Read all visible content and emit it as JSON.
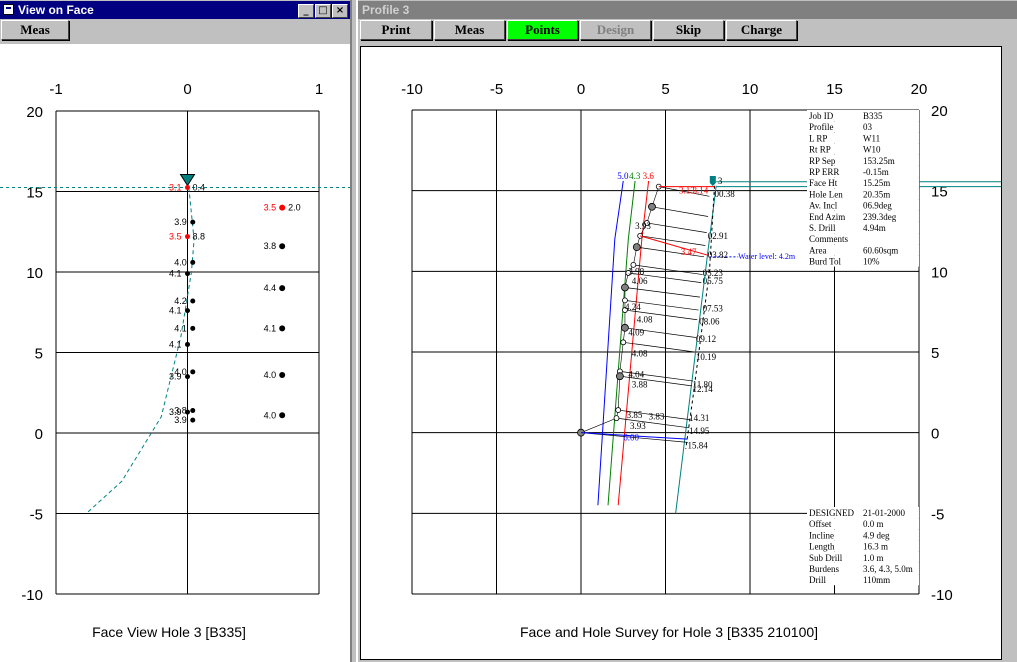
{
  "left_window": {
    "title": "View on Face",
    "buttons": {
      "minimize": "_",
      "maximize": "□",
      "close": "×"
    },
    "toolbar": {
      "meas": "Meas"
    },
    "caption": "Face View Hole 3 [B335]"
  },
  "right_window": {
    "title": "Profile 3",
    "toolbar": {
      "print": "Print",
      "meas": "Meas",
      "points": "Points",
      "design": "Design",
      "skip": "Skip",
      "charge": "Charge"
    },
    "caption": "Face and Hole Survey for Hole  3 [B335 210100]",
    "info_top": [
      [
        "Job ID",
        "B335"
      ],
      [
        "Profile",
        "03"
      ],
      [
        "L RP",
        "W11"
      ],
      [
        "Rt RP",
        "W10"
      ],
      [
        "RP Sep",
        "153.25m"
      ],
      [
        "RP ERR",
        "-0.15m"
      ],
      [
        "Face Ht",
        "15.25m"
      ],
      [
        "Hole Len",
        "20.35m"
      ],
      [
        "Av. Incl",
        "06.9deg"
      ],
      [
        "End Azim",
        "239.3deg"
      ],
      [
        "S. Drill",
        "4.94m"
      ],
      [
        "Comments",
        ""
      ],
      [
        "Area",
        "60.60sqm"
      ],
      [
        "Burd Tol",
        "10%"
      ]
    ],
    "info_bottom": [
      [
        "DESIGNED",
        "21-01-2000"
      ],
      [
        "Offset",
        "0.0 m"
      ],
      [
        "Incline",
        "4.9 deg"
      ],
      [
        "Length",
        "16.3 m"
      ],
      [
        "Sub Drill",
        "1.0 m"
      ],
      [
        "Burdens",
        "3.6, 4.3, 5.0m"
      ],
      [
        "Drill",
        "110mm"
      ]
    ],
    "water_level": "Water level: 4.2m"
  },
  "colors": {
    "accent_active": "#00ff00",
    "title_active": "#000080",
    "red": "#ff0000",
    "teal": "#008080",
    "blue": "#0000ff",
    "green": "#008000"
  },
  "chart_data": [
    {
      "type": "scatter",
      "xlim": [
        -1,
        1
      ],
      "ylim": [
        -10,
        20
      ],
      "x_ticks": [
        "-1",
        "0",
        "1"
      ],
      "y_ticks": [
        "20",
        "15",
        "10",
        "5",
        "0",
        "-5",
        "-10"
      ],
      "face_line_y": 15.25,
      "hole_points": [
        {
          "y": 15.25,
          "lbl_l": "3.1",
          "lbl_r": "0.4",
          "red": true
        },
        {
          "y": 13.1,
          "lbl_l": "3.9",
          "red": false
        },
        {
          "y": 12.2,
          "lbl_l": "3.5",
          "lbl_r": "8.8",
          "red": true
        },
        {
          "y": 10.6,
          "lbl_l": "4.0",
          "red": false
        },
        {
          "y": 9.9,
          "lbl_l": "4.1",
          "red": false
        },
        {
          "y": 8.2,
          "lbl_l": "4.2",
          "red": false
        },
        {
          "y": 7.6,
          "lbl_l": "4.1",
          "red": false
        },
        {
          "y": 6.5,
          "lbl_l": "4.1",
          "red": false
        },
        {
          "y": 5.5,
          "lbl_l": "4.1",
          "red": false
        },
        {
          "y": 3.8,
          "lbl_l": "4.0",
          "red": false
        },
        {
          "y": 3.5,
          "lbl_l": "3.9",
          "red": false
        },
        {
          "y": 1.4,
          "lbl_l": "3.8",
          "red": false
        },
        {
          "y": 1.3,
          "lbl_l": "3.9",
          "red": false
        },
        {
          "y": 0.8,
          "lbl_l": "3.9",
          "red": false
        }
      ],
      "burden_points": [
        {
          "y": 14.0,
          "label": "3.5",
          "val": "2.0",
          "red": true
        },
        {
          "y": 11.6,
          "label": "3.8",
          "red": false
        },
        {
          "y": 9.0,
          "label": "4.4",
          "red": false
        },
        {
          "y": 6.5,
          "label": "4.1",
          "red": false
        },
        {
          "y": 3.6,
          "label": "4.0",
          "red": false
        },
        {
          "y": 1.1,
          "label": "4.0",
          "red": false
        }
      ]
    },
    {
      "type": "line",
      "xlim": [
        -10,
        20
      ],
      "ylim": [
        -10,
        20
      ],
      "x_ticks": [
        "-10",
        "-5",
        "0",
        "5",
        "10",
        "15",
        "20"
      ],
      "y_ticks": [
        "20",
        "15",
        "10",
        "5",
        "0",
        "-5",
        "-10"
      ],
      "face_line_y": 15.25,
      "water_level_y": 10.9,
      "design_lines": [
        {
          "color": "#0000ff",
          "label": "5.0",
          "x": [
            1.0,
            2.0,
            2.5
          ],
          "y": [
            -4.5,
            12.0,
            15.6
          ]
        },
        {
          "color": "#008000",
          "label": "4.3",
          "x": [
            1.6,
            2.8,
            3.2
          ],
          "y": [
            -4.5,
            12.0,
            15.6
          ]
        },
        {
          "color": "#ff0000",
          "label": "3.6",
          "x": [
            2.2,
            3.6,
            4.0
          ],
          "y": [
            -4.5,
            12.0,
            15.6
          ]
        },
        {
          "color": "#008080",
          "x": [
            5.6,
            7.6,
            8.0
          ],
          "y": [
            -5.0,
            12.0,
            15.3
          ]
        }
      ],
      "profile_points": [
        {
          "x": 4.6,
          "y": 15.25
        },
        {
          "x": 4.2,
          "y": 14.0
        },
        {
          "x": 3.9,
          "y": 13.0
        },
        {
          "x": 3.5,
          "y": 12.2
        },
        {
          "x": 3.3,
          "y": 11.5
        },
        {
          "x": 3.1,
          "y": 10.4
        },
        {
          "x": 2.8,
          "y": 9.9
        },
        {
          "x": 2.6,
          "y": 9.0
        },
        {
          "x": 2.6,
          "y": 8.2
        },
        {
          "x": 2.6,
          "y": 7.6
        },
        {
          "x": 2.6,
          "y": 6.5
        },
        {
          "x": 2.5,
          "y": 5.6
        },
        {
          "x": 2.3,
          "y": 3.8
        },
        {
          "x": 2.3,
          "y": 3.5
        },
        {
          "x": 2.2,
          "y": 1.4
        },
        {
          "x": 2.1,
          "y": 0.9
        },
        {
          "x": 0.0,
          "y": 0.0
        }
      ],
      "hole_labels": [
        {
          "x": 7.9,
          "y": 14.8,
          "text": "00.38"
        },
        {
          "x": 7.5,
          "y": 12.2,
          "text": "02.91"
        },
        {
          "x": 7.5,
          "y": 11.0,
          "text": "03.82"
        },
        {
          "x": 7.2,
          "y": 9.9,
          "text": "05.23"
        },
        {
          "x": 7.2,
          "y": 9.4,
          "text": "05.75"
        },
        {
          "x": 7.2,
          "y": 7.7,
          "text": "07.53"
        },
        {
          "x": 7.0,
          "y": 6.9,
          "text": "08.06"
        },
        {
          "x": 6.8,
          "y": 5.8,
          "text": "09.12"
        },
        {
          "x": 6.8,
          "y": 4.7,
          "text": "10.19"
        },
        {
          "x": 6.6,
          "y": 3.0,
          "text": "11.80"
        },
        {
          "x": 6.6,
          "y": 2.7,
          "text": "12.14"
        },
        {
          "x": 6.4,
          "y": 0.9,
          "text": "14.31"
        },
        {
          "x": 6.4,
          "y": 0.1,
          "text": "14.95"
        },
        {
          "x": 6.3,
          "y": -0.8,
          "text": "15.84"
        }
      ],
      "burden_labels": [
        {
          "x": 3.2,
          "y": 12.8,
          "text": "3.93"
        },
        {
          "x": 2.8,
          "y": 10.0,
          "text": "3.98"
        },
        {
          "x": 3.0,
          "y": 9.4,
          "text": "4.06"
        },
        {
          "x": 2.6,
          "y": 7.8,
          "text": "4.24"
        },
        {
          "x": 3.3,
          "y": 7.0,
          "text": "4.08"
        },
        {
          "x": 2.8,
          "y": 6.2,
          "text": "4.09"
        },
        {
          "x": 3.0,
          "y": 4.9,
          "text": "4.08"
        },
        {
          "x": 2.8,
          "y": 3.6,
          "text": "4.04"
        },
        {
          "x": 3.0,
          "y": 3.0,
          "text": "3.88"
        },
        {
          "x": 2.7,
          "y": 1.1,
          "text": "3.85"
        },
        {
          "x": 4.0,
          "y": 1.0,
          "text": "3.83"
        },
        {
          "x": 2.9,
          "y": 0.4,
          "text": "3.93"
        }
      ],
      "red_labels": [
        {
          "x": 5.8,
          "y": 15.0,
          "text": "3.13"
        },
        {
          "x": 6.6,
          "y": 15.0,
          "text": "3.14"
        },
        {
          "x": 5.9,
          "y": 11.2,
          "text": "3.47"
        }
      ],
      "hole_marker": {
        "x": 7.8,
        "y": 15.6,
        "label": "3"
      },
      "bottom_blue_label": {
        "x": 2.5,
        "y": -0.3,
        "text": "6.00"
      }
    }
  ]
}
